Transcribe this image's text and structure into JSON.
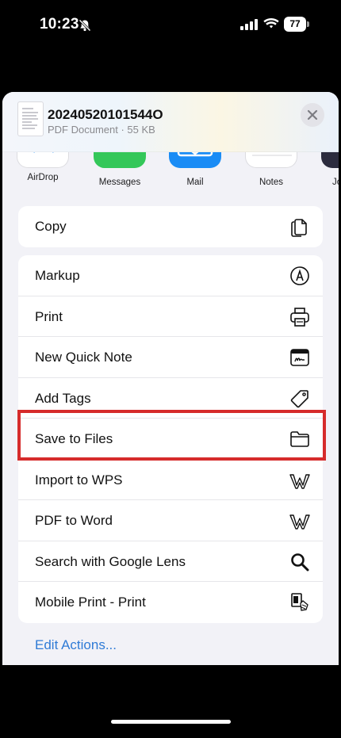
{
  "status_bar": {
    "time": "10:23",
    "battery_level": "77",
    "icons": [
      "bell-slash-icon",
      "cellular-signal-icon",
      "wifi-icon",
      "battery-icon"
    ]
  },
  "share_sheet": {
    "document": {
      "title": "20240520101544O",
      "subtitle": "PDF Document · 55 KB"
    },
    "apps": [
      {
        "label": "AirDrop",
        "icon": "airdrop-icon",
        "color": "#ffffff"
      },
      {
        "label": "Messages",
        "icon": "messages-icon",
        "color": "#34c759"
      },
      {
        "label": "Mail",
        "icon": "mail-icon",
        "color": "#1a8cf5"
      },
      {
        "label": "Notes",
        "icon": "notes-icon",
        "color": "#ffffff"
      },
      {
        "label": "Jo",
        "icon": "app-icon",
        "color": "#2c2c3e"
      }
    ],
    "copy_group": [
      {
        "label": "Copy",
        "icon": "copy-icon"
      }
    ],
    "actions": [
      {
        "label": "Markup",
        "icon": "markup-icon"
      },
      {
        "label": "Print",
        "icon": "printer-icon"
      },
      {
        "label": "New Quick Note",
        "icon": "quick-note-icon"
      },
      {
        "label": "Add Tags",
        "icon": "tag-icon"
      },
      {
        "label": "Save to Files",
        "icon": "folder-icon",
        "highlighted": true
      },
      {
        "label": "Import to WPS",
        "icon": "wps-icon"
      },
      {
        "label": "PDF to Word",
        "icon": "wps-icon"
      },
      {
        "label": "Search with Google Lens",
        "icon": "search-icon"
      },
      {
        "label": "Mobile Print - Print",
        "icon": "mobile-print-icon"
      }
    ],
    "edit_actions_label": "Edit Actions..."
  },
  "colors": {
    "highlight": "#d62b2b",
    "link": "#2f7bd6",
    "sheet_background": "#f2f2f7"
  }
}
